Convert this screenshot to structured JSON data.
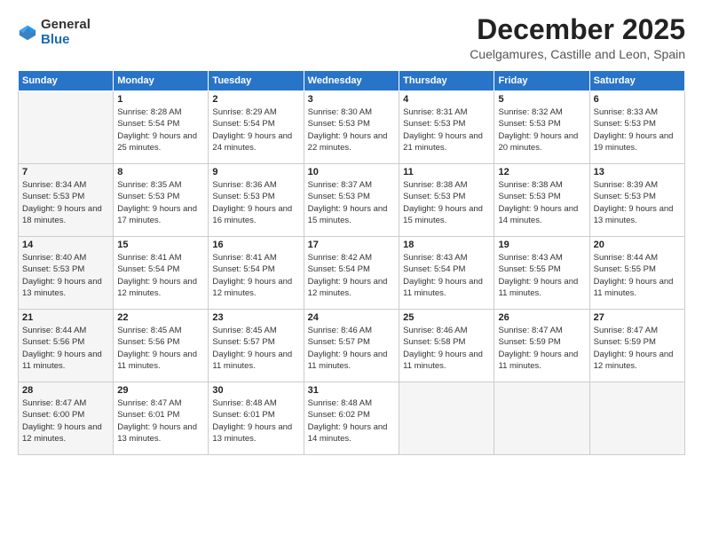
{
  "logo": {
    "general": "General",
    "blue": "Blue"
  },
  "title": "December 2025",
  "location": "Cuelgamures, Castille and Leon, Spain",
  "weekdays": [
    "Sunday",
    "Monday",
    "Tuesday",
    "Wednesday",
    "Thursday",
    "Friday",
    "Saturday"
  ],
  "weeks": [
    [
      {
        "day": "",
        "sunrise": "",
        "sunset": "",
        "daylight": ""
      },
      {
        "day": "1",
        "sunrise": "Sunrise: 8:28 AM",
        "sunset": "Sunset: 5:54 PM",
        "daylight": "Daylight: 9 hours and 25 minutes."
      },
      {
        "day": "2",
        "sunrise": "Sunrise: 8:29 AM",
        "sunset": "Sunset: 5:54 PM",
        "daylight": "Daylight: 9 hours and 24 minutes."
      },
      {
        "day": "3",
        "sunrise": "Sunrise: 8:30 AM",
        "sunset": "Sunset: 5:53 PM",
        "daylight": "Daylight: 9 hours and 22 minutes."
      },
      {
        "day": "4",
        "sunrise": "Sunrise: 8:31 AM",
        "sunset": "Sunset: 5:53 PM",
        "daylight": "Daylight: 9 hours and 21 minutes."
      },
      {
        "day": "5",
        "sunrise": "Sunrise: 8:32 AM",
        "sunset": "Sunset: 5:53 PM",
        "daylight": "Daylight: 9 hours and 20 minutes."
      },
      {
        "day": "6",
        "sunrise": "Sunrise: 8:33 AM",
        "sunset": "Sunset: 5:53 PM",
        "daylight": "Daylight: 9 hours and 19 minutes."
      }
    ],
    [
      {
        "day": "7",
        "sunrise": "Sunrise: 8:34 AM",
        "sunset": "Sunset: 5:53 PM",
        "daylight": "Daylight: 9 hours and 18 minutes."
      },
      {
        "day": "8",
        "sunrise": "Sunrise: 8:35 AM",
        "sunset": "Sunset: 5:53 PM",
        "daylight": "Daylight: 9 hours and 17 minutes."
      },
      {
        "day": "9",
        "sunrise": "Sunrise: 8:36 AM",
        "sunset": "Sunset: 5:53 PM",
        "daylight": "Daylight: 9 hours and 16 minutes."
      },
      {
        "day": "10",
        "sunrise": "Sunrise: 8:37 AM",
        "sunset": "Sunset: 5:53 PM",
        "daylight": "Daylight: 9 hours and 15 minutes."
      },
      {
        "day": "11",
        "sunrise": "Sunrise: 8:38 AM",
        "sunset": "Sunset: 5:53 PM",
        "daylight": "Daylight: 9 hours and 15 minutes."
      },
      {
        "day": "12",
        "sunrise": "Sunrise: 8:38 AM",
        "sunset": "Sunset: 5:53 PM",
        "daylight": "Daylight: 9 hours and 14 minutes."
      },
      {
        "day": "13",
        "sunrise": "Sunrise: 8:39 AM",
        "sunset": "Sunset: 5:53 PM",
        "daylight": "Daylight: 9 hours and 13 minutes."
      }
    ],
    [
      {
        "day": "14",
        "sunrise": "Sunrise: 8:40 AM",
        "sunset": "Sunset: 5:53 PM",
        "daylight": "Daylight: 9 hours and 13 minutes."
      },
      {
        "day": "15",
        "sunrise": "Sunrise: 8:41 AM",
        "sunset": "Sunset: 5:54 PM",
        "daylight": "Daylight: 9 hours and 12 minutes."
      },
      {
        "day": "16",
        "sunrise": "Sunrise: 8:41 AM",
        "sunset": "Sunset: 5:54 PM",
        "daylight": "Daylight: 9 hours and 12 minutes."
      },
      {
        "day": "17",
        "sunrise": "Sunrise: 8:42 AM",
        "sunset": "Sunset: 5:54 PM",
        "daylight": "Daylight: 9 hours and 12 minutes."
      },
      {
        "day": "18",
        "sunrise": "Sunrise: 8:43 AM",
        "sunset": "Sunset: 5:54 PM",
        "daylight": "Daylight: 9 hours and 11 minutes."
      },
      {
        "day": "19",
        "sunrise": "Sunrise: 8:43 AM",
        "sunset": "Sunset: 5:55 PM",
        "daylight": "Daylight: 9 hours and 11 minutes."
      },
      {
        "day": "20",
        "sunrise": "Sunrise: 8:44 AM",
        "sunset": "Sunset: 5:55 PM",
        "daylight": "Daylight: 9 hours and 11 minutes."
      }
    ],
    [
      {
        "day": "21",
        "sunrise": "Sunrise: 8:44 AM",
        "sunset": "Sunset: 5:56 PM",
        "daylight": "Daylight: 9 hours and 11 minutes."
      },
      {
        "day": "22",
        "sunrise": "Sunrise: 8:45 AM",
        "sunset": "Sunset: 5:56 PM",
        "daylight": "Daylight: 9 hours and 11 minutes."
      },
      {
        "day": "23",
        "sunrise": "Sunrise: 8:45 AM",
        "sunset": "Sunset: 5:57 PM",
        "daylight": "Daylight: 9 hours and 11 minutes."
      },
      {
        "day": "24",
        "sunrise": "Sunrise: 8:46 AM",
        "sunset": "Sunset: 5:57 PM",
        "daylight": "Daylight: 9 hours and 11 minutes."
      },
      {
        "day": "25",
        "sunrise": "Sunrise: 8:46 AM",
        "sunset": "Sunset: 5:58 PM",
        "daylight": "Daylight: 9 hours and 11 minutes."
      },
      {
        "day": "26",
        "sunrise": "Sunrise: 8:47 AM",
        "sunset": "Sunset: 5:59 PM",
        "daylight": "Daylight: 9 hours and 11 minutes."
      },
      {
        "day": "27",
        "sunrise": "Sunrise: 8:47 AM",
        "sunset": "Sunset: 5:59 PM",
        "daylight": "Daylight: 9 hours and 12 minutes."
      }
    ],
    [
      {
        "day": "28",
        "sunrise": "Sunrise: 8:47 AM",
        "sunset": "Sunset: 6:00 PM",
        "daylight": "Daylight: 9 hours and 12 minutes."
      },
      {
        "day": "29",
        "sunrise": "Sunrise: 8:47 AM",
        "sunset": "Sunset: 6:01 PM",
        "daylight": "Daylight: 9 hours and 13 minutes."
      },
      {
        "day": "30",
        "sunrise": "Sunrise: 8:48 AM",
        "sunset": "Sunset: 6:01 PM",
        "daylight": "Daylight: 9 hours and 13 minutes."
      },
      {
        "day": "31",
        "sunrise": "Sunrise: 8:48 AM",
        "sunset": "Sunset: 6:02 PM",
        "daylight": "Daylight: 9 hours and 14 minutes."
      },
      {
        "day": "",
        "sunrise": "",
        "sunset": "",
        "daylight": ""
      },
      {
        "day": "",
        "sunrise": "",
        "sunset": "",
        "daylight": ""
      },
      {
        "day": "",
        "sunrise": "",
        "sunset": "",
        "daylight": ""
      }
    ]
  ]
}
